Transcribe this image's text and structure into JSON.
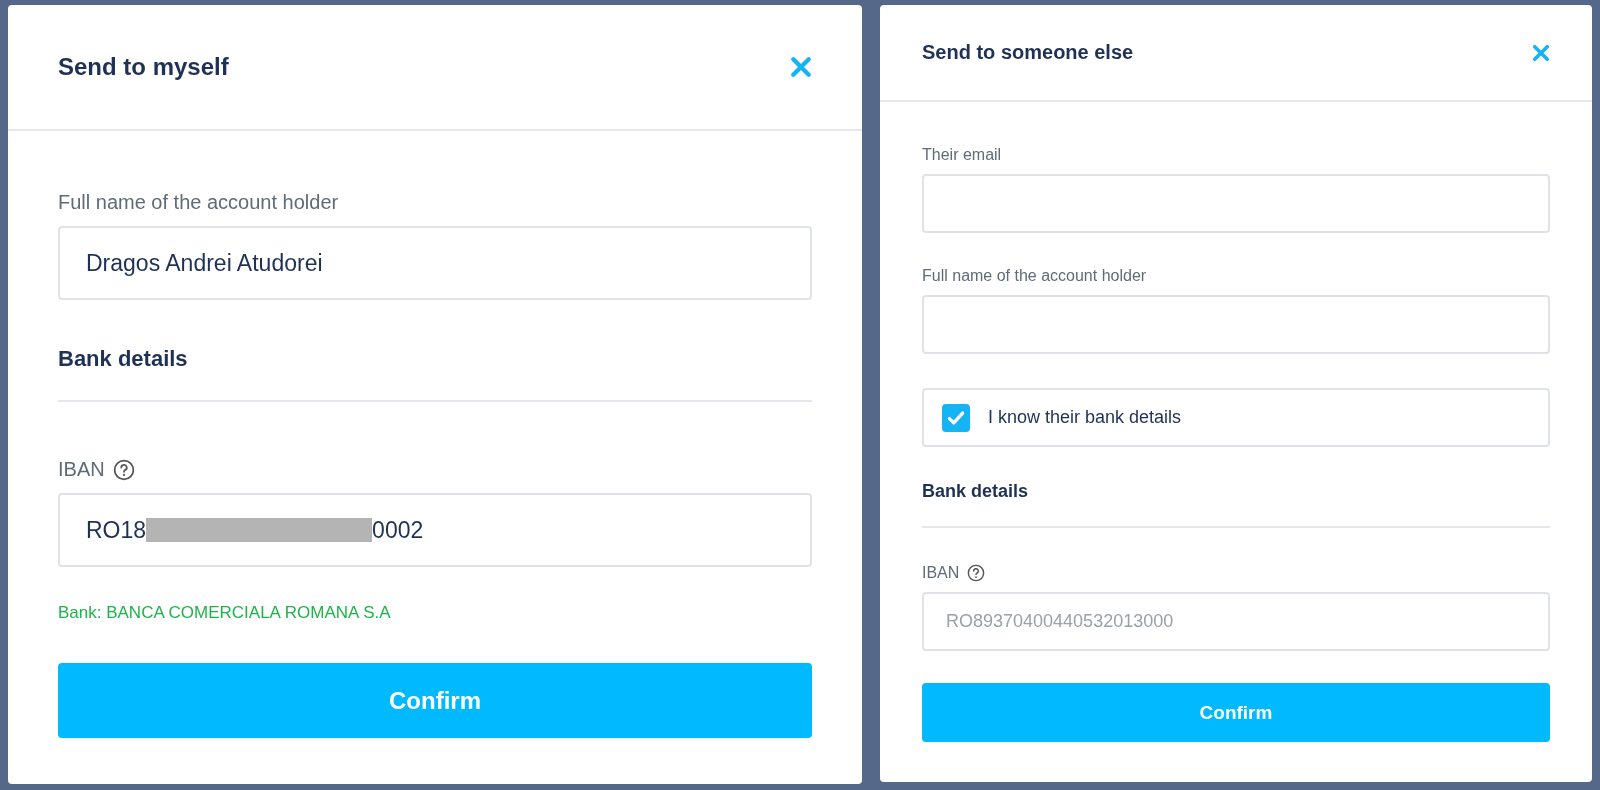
{
  "dialogs": [
    {
      "title": "Send to myself",
      "fields": [
        {
          "kind": "input",
          "label": "Full name of the account holder",
          "value": "Dragos Andrei Atudorei"
        },
        {
          "kind": "section",
          "label": "Bank details"
        },
        {
          "kind": "iban",
          "label": "IBAN",
          "help": true,
          "value_start": "RO18",
          "value_end": "0002",
          "redacted": true,
          "bank": "Bank: BANCA COMERCIALA ROMANA S.A"
        }
      ],
      "button": "Confirm"
    },
    {
      "title": "Send to someone else",
      "fields": [
        {
          "kind": "input",
          "label": "Their email"
        },
        {
          "kind": "input",
          "label": "Full name of the account holder"
        },
        {
          "kind": "checkbox",
          "label": "I know their bank details",
          "checked": true
        },
        {
          "kind": "section",
          "label": "Bank details"
        },
        {
          "kind": "iban",
          "label": "IBAN",
          "help": true,
          "placeholder": "RO89370400440532013000"
        }
      ],
      "button": "Confirm"
    }
  ]
}
